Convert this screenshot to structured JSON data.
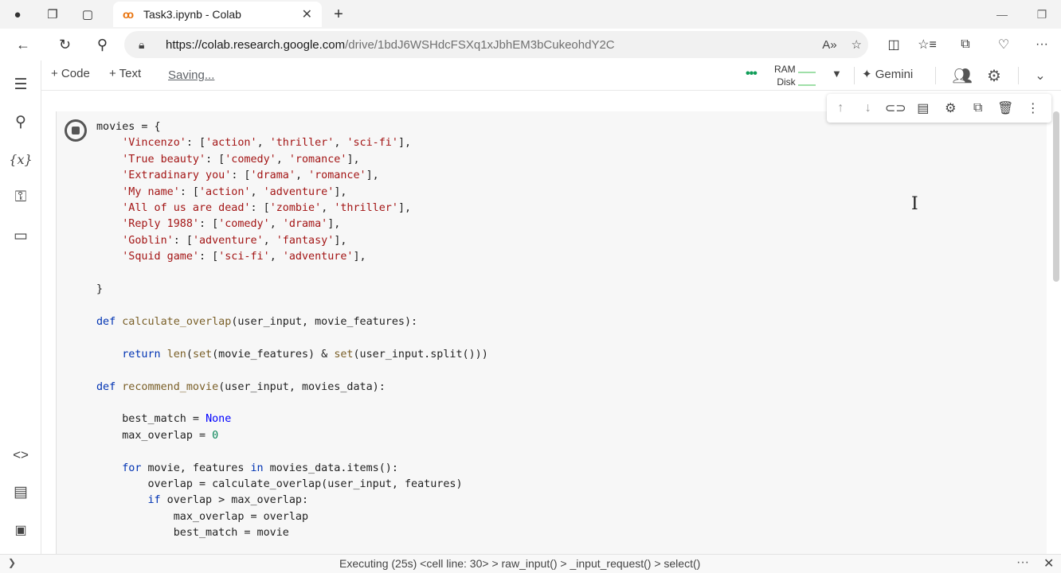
{
  "browser": {
    "tab_title": "Task3.ipynb - Colab",
    "url_host": "https://colab.research.google.com",
    "url_path": "/drive/1bdJ6WSHdcFSXq1xJbhEM3bCukeohdY2C"
  },
  "toolbar": {
    "code_label": "+ Code",
    "text_label": "+ Text",
    "saving_label": "Saving...",
    "ram_label": "RAM",
    "disk_label": "Disk",
    "gemini_label": "✦ Gemini"
  },
  "status": {
    "text": "Executing (25s) <cell line: 30> > raw_input() > _input_request() > select()"
  },
  "icons": {
    "leftbar": [
      "toc-icon",
      "search-icon",
      "variables-icon",
      "secrets-icon",
      "files-icon",
      "code-snippets-icon",
      "command-palette-icon",
      "terminal-icon"
    ],
    "cell_toolbar": [
      "arrow-up-icon",
      "arrow-down-icon",
      "link-icon",
      "comment-icon",
      "settings-icon",
      "mirror-cell-icon",
      "delete-icon",
      "more-vert-icon"
    ]
  },
  "colors": {
    "keyword": "#0033b3",
    "function": "#795e26",
    "string": "#a31515",
    "number": "#098658",
    "accent_green": "#0f9d58"
  }
}
